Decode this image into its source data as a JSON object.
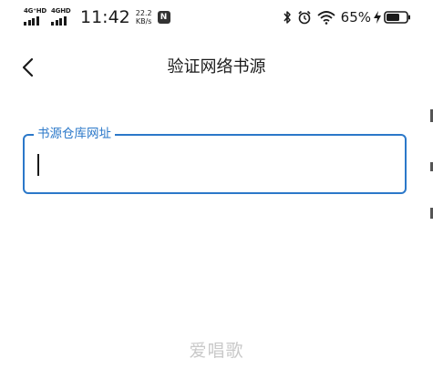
{
  "status_bar": {
    "sim1_network": "4G⁺HD",
    "sim2_network": "4GHD",
    "time": "11:42",
    "net_speed_value": "22.2",
    "net_speed_unit": "KB/s",
    "app_badge_glyph": "N",
    "battery_percent": "65%",
    "icons": [
      "bluetooth-icon",
      "alarm-icon",
      "wifi-icon",
      "charging-icon",
      "battery-icon"
    ]
  },
  "header": {
    "title": "验证网络书源",
    "back_icon": "chevron-left-icon"
  },
  "form": {
    "repo_url_label": "书源仓库网址",
    "repo_url_value": "",
    "accent_color": "#2b78c9"
  },
  "watermark": {
    "text": "爱唱歌"
  }
}
